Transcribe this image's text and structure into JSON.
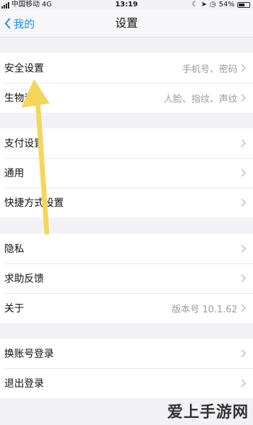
{
  "status_bar": {
    "carrier": "中国移动",
    "network": "4G",
    "time": "13:19",
    "battery": "54%"
  },
  "nav": {
    "back_label": "我的",
    "title": "设置"
  },
  "groups": [
    [
      {
        "label": "安全设置",
        "value": "手机号、密码"
      },
      {
        "label": "生物识别",
        "value": "人脸、指纹、声纹"
      }
    ],
    [
      {
        "label": "支付设置",
        "value": ""
      },
      {
        "label": "通用",
        "value": ""
      },
      {
        "label": "快捷方式设置",
        "value": ""
      }
    ],
    [
      {
        "label": "隐私",
        "value": ""
      },
      {
        "label": "求助反馈",
        "value": ""
      },
      {
        "label": "关于",
        "value": "版本号 10.1.62"
      }
    ],
    [
      {
        "label": "换账号登录",
        "value": ""
      },
      {
        "label": "退出登录",
        "value": ""
      }
    ]
  ],
  "annotation": {
    "color": "#f6d55c"
  },
  "watermark": "爱上手游网",
  "colors": {
    "accent": "#1a8cf0",
    "background": "#f2f2f6"
  }
}
